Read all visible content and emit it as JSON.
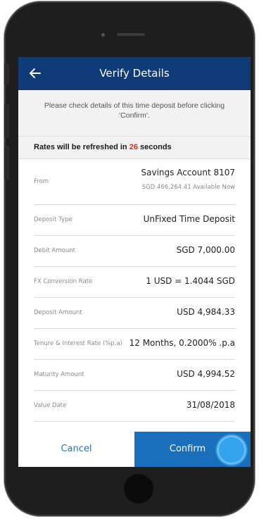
{
  "header": {
    "title": "Verify Details",
    "back_icon": "back-arrow-icon"
  },
  "notice": {
    "text": "Please check details of this time deposit before clicking 'Confirm'."
  },
  "refresh": {
    "prefix": "Rates will be refreshed in ",
    "seconds": "26",
    "suffix": " seconds",
    "seconds_color": "#e0231c"
  },
  "details": {
    "from": {
      "label": "From",
      "value": "Savings Account 8107",
      "sub": "SGD 466,264.41 Available Now"
    },
    "rows": [
      {
        "label": "Deposit Type",
        "value": "UnFixed Time Deposit"
      },
      {
        "label": "Debit Amount",
        "value": "SGD 7,000.00"
      },
      {
        "label": "FX Conversion Rate",
        "value": "1 USD = 1.4044 SGD"
      },
      {
        "label": "Deposit Amount",
        "value": "USD 4,984.33"
      },
      {
        "label": "Tenure & Interest Rate (%p.a)",
        "value": "12 Months, 0.2000% .p.a"
      },
      {
        "label": "Maturity Amount",
        "value": "USD 4,994.52"
      },
      {
        "label": "Value Date",
        "value": "31/08/2018"
      }
    ]
  },
  "actions": {
    "cancel_label": "Cancel",
    "confirm_label": "Confirm"
  },
  "colors": {
    "header_bg": "#0f3c78",
    "confirm_bg": "#1a6fbc",
    "cancel_text": "#2a72b8"
  }
}
